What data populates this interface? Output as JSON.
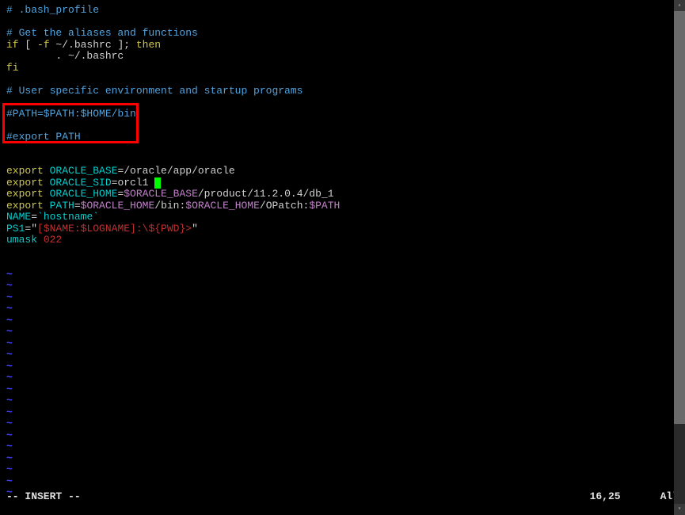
{
  "lines": {
    "l1": "# .bash_profile",
    "l3": "# Get the aliases and functions",
    "l4a": "if",
    "l4b": " [ ",
    "l4c": "-f",
    "l4d": " ~/.bashrc ",
    "l4e": "]; ",
    "l4f": "then",
    "l5": "        . ~/.bashrc",
    "l6": "fi",
    "l8": "# User specific environment and startup programs",
    "l10": "#PATH=$PATH:$HOME/bin",
    "l12": "#export PATH",
    "l15a": "export",
    "l15b": " ORACLE_BASE",
    "l15c": "=",
    "l15d": "/oracle/app/oracle",
    "l16a": "export",
    "l16b": " ORACLE_SID",
    "l16c": "=",
    "l16d": "orcl1 ",
    "l17a": "export",
    "l17b": " ORACLE_HOME",
    "l17c": "=",
    "l17d": "$ORACLE_BASE",
    "l17e": "/product/11.2.0.4/db_1",
    "l18a": "export",
    "l18b": " PATH",
    "l18c": "=",
    "l18d": "$ORACLE_HOME",
    "l18e": "/bin:",
    "l18f": "$ORACLE_HOME",
    "l18g": "/OPatch:",
    "l18h": "$PATH",
    "l19a": "NAME",
    "l19b": "=",
    "l19c": "`hostname`",
    "l20a": "PS1",
    "l20b": "=",
    "l20c": "\"",
    "l20d": "[$NAME:$LOGNAME]:\\${PWD}>",
    "l20e": "\"",
    "l21a": "umask ",
    "l21b": "022",
    "tilde": "~"
  },
  "status": {
    "mode": "-- INSERT --",
    "position": "16,25",
    "view": "All"
  }
}
